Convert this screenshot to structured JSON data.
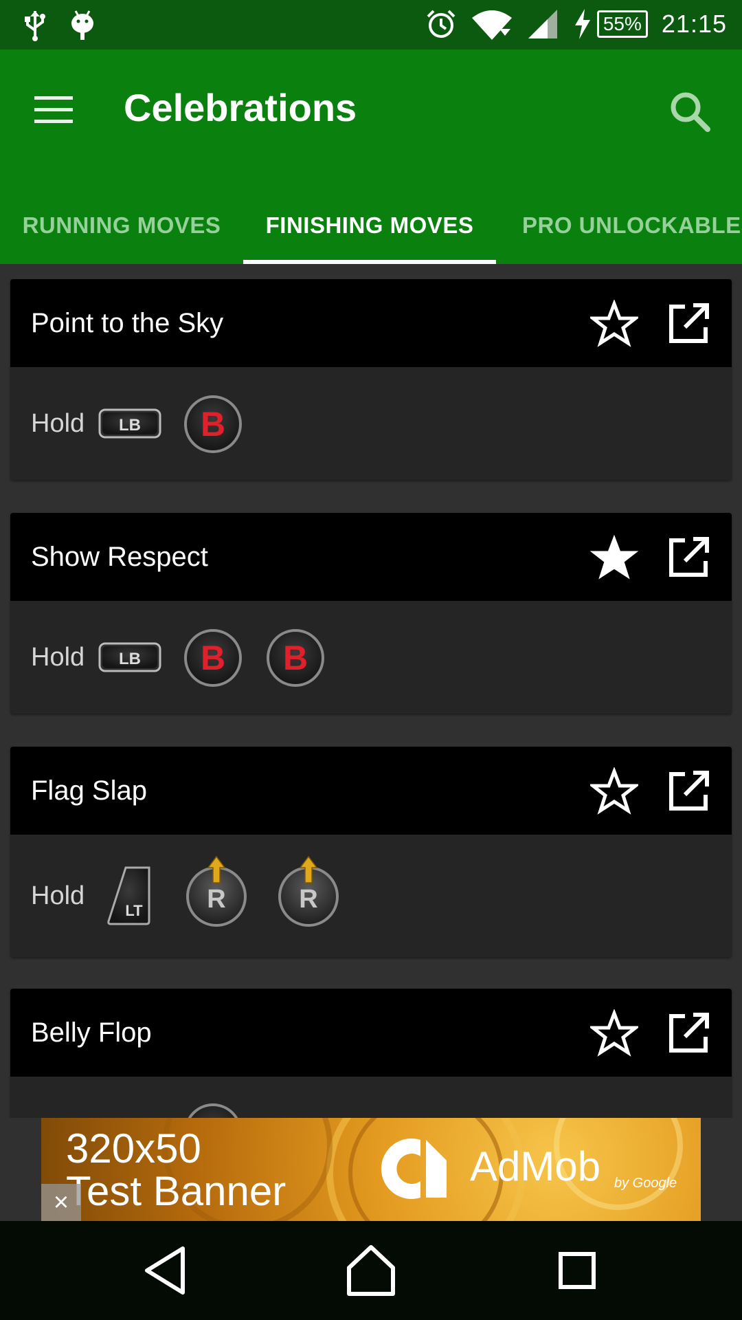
{
  "status_bar": {
    "time": "21:15",
    "battery_percent": "55%",
    "icons": [
      "usb-icon",
      "android-icon",
      "alarm-icon",
      "wifi-icon",
      "signal-icon",
      "charging-icon"
    ]
  },
  "app_bar": {
    "title": "Celebrations",
    "menu_icon": "menu-icon",
    "search_icon": "search-icon",
    "background": "#0a800f"
  },
  "tabs": [
    {
      "label": "RUNNING MOVES",
      "active": false
    },
    {
      "label": "FINISHING MOVES",
      "active": true
    },
    {
      "label": "PRO UNLOCKABLES",
      "active": false
    }
  ],
  "moves": [
    {
      "title": "Point to the Sky",
      "favorite": false,
      "prefix": "Hold",
      "inputs": [
        "LB",
        "B"
      ]
    },
    {
      "title": "Show Respect",
      "favorite": true,
      "prefix": "Hold",
      "inputs": [
        "LB",
        "B",
        "B"
      ]
    },
    {
      "title": "Flag Slap",
      "favorite": false,
      "prefix": "Hold",
      "inputs": [
        "LT",
        "R-stick-up",
        "R-stick-up"
      ]
    },
    {
      "title": "Belly Flop",
      "favorite": false,
      "prefix": "",
      "inputs": []
    }
  ],
  "button_glyphs": {
    "LB": "LB",
    "B": "B",
    "LT": "LT",
    "R": "R"
  },
  "ad": {
    "line1": "320x50",
    "line2": "Test Banner",
    "brand": "AdMob",
    "by": "by Google",
    "close": "×"
  },
  "nav_bar": {
    "icons": [
      "back-icon",
      "home-icon",
      "recents-icon"
    ]
  }
}
